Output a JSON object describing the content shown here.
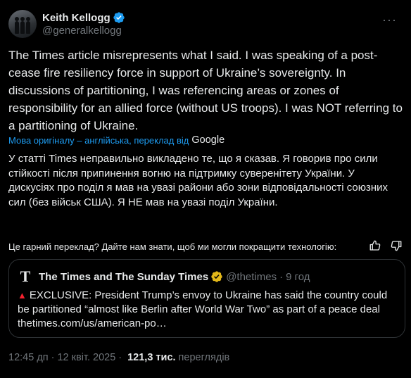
{
  "author": {
    "display_name": "Keith Kellogg",
    "handle": "@generalkellogg"
  },
  "more_icon": "more-horizontal-icon",
  "tweet_text": "The Times article misrepresents what I said. I was speaking of a post-cease fire resiliency force in support of Ukraine’s sovereignty. In discussions of partitioning, I was referencing areas or zones of responsibility for an allied force (without US troops). I was NOT referring to a partitioning of Ukraine.",
  "translation": {
    "note": "Мова оригіналу – англійська, переклад від",
    "provider": "Google",
    "text": "У статті Times неправильно викладено те, що я сказав. Я говорив про сили стійкості після припинення вогню на підтримку суверенітету України. У дискусіях про поділ я мав на увазі райони або зони відповідальності союзних сил (без військ США). Я НЕ мав на увазі поділ України.",
    "feedback_prompt": "Це гарний переклад? Дайте нам знати, щоб ми могли покращити технологію:"
  },
  "quote": {
    "logo": "T",
    "name": "The Times and The Sunday Times",
    "handle": "@thetimes",
    "dot": "·",
    "time": "9 год",
    "badge": "▲",
    "text": "EXCLUSIVE: President Trump’s envoy to Ukraine has said the country could be partitioned “almost like Berlin after World War Two” as part of a peace deal thetimes.com/us/american-po…"
  },
  "meta": {
    "time": "12:45 дп",
    "dot1": "·",
    "date": "12 квіт. 2025",
    "dot2": "·",
    "views_count": "121,3 тис.",
    "views_label": "переглядів"
  },
  "colors": {
    "background": "#000000",
    "text": "#e7e9ea",
    "secondary": "#71767b",
    "accent": "#1d9bf0",
    "verified_gold": "#e2b719",
    "border": "#2f3336",
    "alert_red": "#f4212e"
  }
}
